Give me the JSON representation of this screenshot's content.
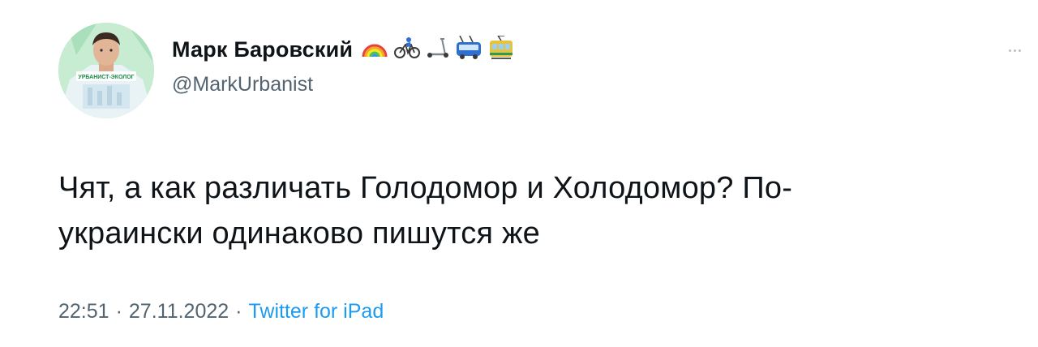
{
  "author": {
    "display_name": "Марк Баровский",
    "handle": "@MarkUrbanist",
    "name_emoji": [
      "rainbow-icon",
      "cyclist-icon",
      "scooter-icon",
      "trolleybus-icon",
      "tram-icon"
    ],
    "avatar_badge": "УРБАНИСТ-ЭКОЛОГ"
  },
  "tweet": {
    "text_lines": [
      "Чят, а как различать Голодомор и Холодомор? По-",
      "украински одинаково пишутся же"
    ]
  },
  "meta": {
    "time": "22:51",
    "separator": "·",
    "date": "27.11.2022",
    "source": "Twitter for iPad"
  },
  "colors": {
    "text": "#0f1419",
    "secondary": "#536471",
    "link": "#1d9bf0",
    "avatar_bg": "#c7ecd2"
  }
}
